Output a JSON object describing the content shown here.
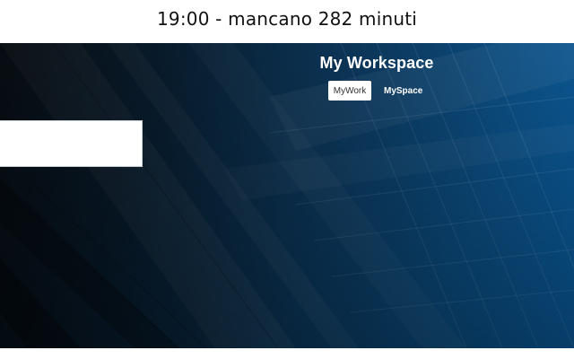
{
  "header": {
    "countdown_text": "19:00 - mancano 282 minuti"
  },
  "workspace": {
    "title": "My Workspace",
    "tabs": [
      {
        "label": "MyWork",
        "active": true
      },
      {
        "label": "MySpace",
        "active": false
      }
    ]
  },
  "colors": {
    "hero_dark": "#0f1b26",
    "hero_light": "#0a5ea1",
    "panel": "#ffffff"
  }
}
